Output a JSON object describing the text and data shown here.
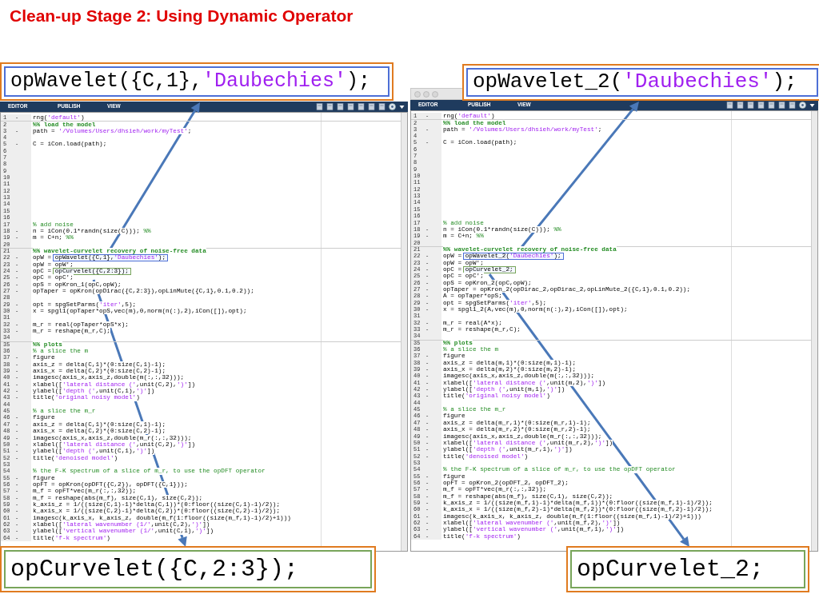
{
  "slide_title": "Clean-up Stage 2: Using Dynamic Operator",
  "callouts": [
    {
      "kind": "top-left",
      "color": "#4d6fd6",
      "parts": [
        {
          "kind": "code",
          "text": "opWavelet({C,1},"
        },
        {
          "kind": "string",
          "text": "'Daubechies'"
        },
        {
          "kind": "code",
          "text": ");"
        }
      ]
    },
    {
      "kind": "top-right",
      "color": "#4d6fd6",
      "parts": [
        {
          "kind": "code",
          "text": "opWavelet_2("
        },
        {
          "kind": "string",
          "text": "'Daubechies'"
        },
        {
          "kind": "code",
          "text": ");"
        }
      ]
    },
    {
      "kind": "bottom-left",
      "color": "#78a55a",
      "parts": [
        {
          "kind": "code",
          "text": "opCurvelet({C,2:3});"
        }
      ]
    },
    {
      "kind": "bottom-right",
      "color": "#78a55a",
      "parts": [
        {
          "kind": "code",
          "text": "opCurvelet_2;"
        }
      ]
    }
  ],
  "editors": [
    {
      "title_bar": false,
      "tabs": [
        {
          "label": "EDITOR"
        },
        {
          "label": "PUBLISH"
        },
        {
          "label": "VIEW"
        }
      ],
      "lines": [
        {
          "num": "1",
          "marker": "-",
          "parts": [
            {
              "kind": "code",
              "text": "rng("
            },
            {
              "kind": "string",
              "text": "'default'"
            },
            {
              "kind": "code",
              "text": ")"
            }
          ]
        },
        {
          "num": "2",
          "parts": [
            {
              "kind": "cell",
              "text": "%% load the model"
            }
          ]
        },
        {
          "num": "3",
          "marker": "-",
          "parts": [
            {
              "kind": "code",
              "text": "path = "
            },
            {
              "kind": "string",
              "text": "'/Volumes/Users/dhsieh/work/myTest'"
            },
            {
              "kind": "code",
              "text": ";"
            }
          ]
        },
        {
          "num": "4"
        },
        {
          "num": "5",
          "marker": "-",
          "parts": [
            {
              "kind": "code",
              "text": "C = iCon.load(path);"
            }
          ]
        },
        {
          "num": "6"
        },
        {
          "num": "7"
        },
        {
          "num": "8"
        },
        {
          "num": "9"
        },
        {
          "num": "10"
        },
        {
          "num": "11"
        },
        {
          "num": "12"
        },
        {
          "num": "13"
        },
        {
          "num": "14"
        },
        {
          "num": "15"
        },
        {
          "num": "16"
        },
        {
          "num": "17",
          "parts": [
            {
              "kind": "comment",
              "text": "% add noise"
            }
          ]
        },
        {
          "num": "18",
          "marker": "-",
          "parts": [
            {
              "kind": "code",
              "text": "n = iCon(0.1*randn(size(C))); "
            },
            {
              "kind": "comment",
              "text": "%%"
            }
          ]
        },
        {
          "num": "19",
          "marker": "-",
          "parts": [
            {
              "kind": "code",
              "text": "m = C+n; "
            },
            {
              "kind": "comment",
              "text": "%%"
            }
          ]
        },
        {
          "num": "20"
        },
        {
          "num": "21",
          "parts": [
            {
              "kind": "cell",
              "text": "%% wavelet-curvelet recovery of noise-free data"
            }
          ]
        },
        {
          "num": "22",
          "marker": "-",
          "parts": [
            {
              "kind": "code",
              "text": "opW = "
            },
            {
              "kind": "box",
              "color": "#4d6fd6",
              "parts": [
                {
                  "kind": "code",
                  "text": "opWavelet({C,1},"
                },
                {
                  "kind": "string",
                  "text": "'Daubechies'"
                },
                {
                  "kind": "code",
                  "text": ");"
                }
              ]
            }
          ]
        },
        {
          "num": "23",
          "marker": "-",
          "parts": [
            {
              "kind": "code",
              "text": "opW = opW';"
            }
          ]
        },
        {
          "num": "24",
          "marker": "-",
          "parts": [
            {
              "kind": "code",
              "text": "opC = "
            },
            {
              "kind": "box",
              "color": "#78a55a",
              "parts": [
                {
                  "kind": "code",
                  "text": "opCurvelet({C,2:3});"
                }
              ]
            }
          ]
        },
        {
          "num": "25",
          "marker": "-",
          "parts": [
            {
              "kind": "code",
              "text": "opC = opC';"
            }
          ]
        },
        {
          "num": "26",
          "marker": "-",
          "parts": [
            {
              "kind": "code",
              "text": "opS = opKron_1(opC,opW);"
            }
          ]
        },
        {
          "num": "27",
          "marker": "-",
          "parts": [
            {
              "kind": "code",
              "text": "opTaper = opKron(opDirac({C,2:3}),opLinMute({C,1},0.1,0.2));"
            }
          ]
        },
        {
          "num": "28"
        },
        {
          "num": "29",
          "marker": "-",
          "parts": [
            {
              "kind": "code",
              "text": "opt = spgSetParms("
            },
            {
              "kind": "string",
              "text": "'iter'"
            },
            {
              "kind": "code",
              "text": ",5);"
            }
          ]
        },
        {
          "num": "30",
          "marker": "-",
          "parts": [
            {
              "kind": "code",
              "text": "x = spgl1(opTaper*opS,vec(m),0,norm(n(:),2),iCon([]),opt);"
            }
          ]
        },
        {
          "num": "31"
        },
        {
          "num": "32",
          "marker": "-",
          "parts": [
            {
              "kind": "code",
              "text": "m_r = real(opTaper*opS*x);"
            }
          ]
        },
        {
          "num": "33",
          "marker": "-",
          "parts": [
            {
              "kind": "code",
              "text": "m_r = reshape(m_r,C);"
            }
          ]
        },
        {
          "num": "34"
        },
        {
          "num": "35",
          "parts": [
            {
              "kind": "cell",
              "text": "%% plots"
            }
          ]
        },
        {
          "num": "36",
          "parts": [
            {
              "kind": "comment",
              "text": "% a slice the m"
            }
          ]
        },
        {
          "num": "37",
          "marker": "-",
          "parts": [
            {
              "kind": "code",
              "text": "figure"
            }
          ]
        },
        {
          "num": "38",
          "marker": "-",
          "parts": [
            {
              "kind": "code",
              "text": "axis_z = delta(C,1)*(0:size(C,1)-1);"
            }
          ]
        },
        {
          "num": "39",
          "marker": "-",
          "parts": [
            {
              "kind": "code",
              "text": "axis_x = delta(C,2)*(0:size(C,2)-1);"
            }
          ]
        },
        {
          "num": "40",
          "marker": "-",
          "parts": [
            {
              "kind": "code",
              "text": "imagesc(axis_x,axis_z,double(m(:,:,32)));"
            }
          ]
        },
        {
          "num": "41",
          "marker": "-",
          "parts": [
            {
              "kind": "code",
              "text": "xlabel(["
            },
            {
              "kind": "string",
              "text": "'lateral distance ('"
            },
            {
              "kind": "code",
              "text": ",unit(C,2),"
            },
            {
              "kind": "string",
              "text": "')'"
            },
            {
              "kind": "code",
              "text": "])"
            }
          ]
        },
        {
          "num": "42",
          "marker": "-",
          "parts": [
            {
              "kind": "code",
              "text": "ylabel(["
            },
            {
              "kind": "string",
              "text": "'depth ('"
            },
            {
              "kind": "code",
              "text": ",unit(C,1),"
            },
            {
              "kind": "string",
              "text": "')'"
            },
            {
              "kind": "code",
              "text": "])"
            }
          ]
        },
        {
          "num": "43",
          "marker": "-",
          "parts": [
            {
              "kind": "code",
              "text": "title("
            },
            {
              "kind": "string",
              "text": "'original noisy model'"
            },
            {
              "kind": "code",
              "text": ")"
            }
          ]
        },
        {
          "num": "44"
        },
        {
          "num": "45",
          "parts": [
            {
              "kind": "comment",
              "text": "% a slice the m_r"
            }
          ]
        },
        {
          "num": "46",
          "marker": "-",
          "parts": [
            {
              "kind": "code",
              "text": "figure"
            }
          ]
        },
        {
          "num": "47",
          "marker": "-",
          "parts": [
            {
              "kind": "code",
              "text": "axis_z = delta(C,1)*(0:size(C,1)-1);"
            }
          ]
        },
        {
          "num": "48",
          "marker": "-",
          "parts": [
            {
              "kind": "code",
              "text": "axis_x = delta(C,2)*(0:size(C,2)-1);"
            }
          ]
        },
        {
          "num": "49",
          "marker": "-",
          "parts": [
            {
              "kind": "code",
              "text": "imagesc(axis_x,axis_z,double(m_r(:,:,32)));"
            }
          ]
        },
        {
          "num": "50",
          "marker": "-",
          "parts": [
            {
              "kind": "code",
              "text": "xlabel(["
            },
            {
              "kind": "string",
              "text": "'lateral distance ('"
            },
            {
              "kind": "code",
              "text": ",unit(C,2),"
            },
            {
              "kind": "string",
              "text": "')'"
            },
            {
              "kind": "code",
              "text": "])"
            }
          ]
        },
        {
          "num": "51",
          "marker": "-",
          "parts": [
            {
              "kind": "code",
              "text": "ylabel(["
            },
            {
              "kind": "string",
              "text": "'depth ('"
            },
            {
              "kind": "code",
              "text": ",unit(C,1),"
            },
            {
              "kind": "string",
              "text": "')'"
            },
            {
              "kind": "code",
              "text": "])"
            }
          ]
        },
        {
          "num": "52",
          "marker": "-",
          "parts": [
            {
              "kind": "code",
              "text": "title("
            },
            {
              "kind": "string",
              "text": "'denoised model'"
            },
            {
              "kind": "code",
              "text": ")"
            }
          ]
        },
        {
          "num": "53"
        },
        {
          "num": "54",
          "parts": [
            {
              "kind": "comment",
              "text": "% the F-K spectrum of a slice of m_r, to use the opDFT operator"
            }
          ]
        },
        {
          "num": "55",
          "marker": "-",
          "parts": [
            {
              "kind": "code",
              "text": "figure"
            }
          ]
        },
        {
          "num": "56",
          "marker": "-",
          "parts": [
            {
              "kind": "code",
              "text": "opFT = opKron(opDFT({C,2}), opDFT({C,1}));"
            }
          ]
        },
        {
          "num": "57",
          "marker": "-",
          "parts": [
            {
              "kind": "code",
              "text": "m_f = opFT*vec(m_r(:,:,32));"
            }
          ]
        },
        {
          "num": "58",
          "marker": "-",
          "parts": [
            {
              "kind": "code",
              "text": "m_f = reshape(abs(m_f), size(C,1), size(C,2));"
            }
          ]
        },
        {
          "num": "59",
          "marker": "-",
          "parts": [
            {
              "kind": "code",
              "text": "k_axis_z = 1/((size(C,1)-1)*delta(C,1))*(0:floor((size(C,1)-1)/2));"
            }
          ]
        },
        {
          "num": "60",
          "marker": "-",
          "parts": [
            {
              "kind": "code",
              "text": "k_axis_x = 1/((size(C,2)-1)*delta(C,2))*(0:floor((size(C,2)-1)/2));"
            }
          ]
        },
        {
          "num": "61",
          "marker": "-",
          "parts": [
            {
              "kind": "code",
              "text": "imagesc(k_axis_x, k_axis_z, double(m_f(1:floor((size(m_f,1)-1)/2)+1)))"
            }
          ]
        },
        {
          "num": "62",
          "marker": "-",
          "parts": [
            {
              "kind": "code",
              "text": "xlabel(["
            },
            {
              "kind": "string",
              "text": "'lateral wavenumber (1/'"
            },
            {
              "kind": "code",
              "text": ",unit(C,2),"
            },
            {
              "kind": "string",
              "text": "')'"
            },
            {
              "kind": "code",
              "text": "])"
            }
          ]
        },
        {
          "num": "63",
          "marker": "-",
          "parts": [
            {
              "kind": "code",
              "text": "ylabel(["
            },
            {
              "kind": "string",
              "text": "'vertical wavenumber (1/'"
            },
            {
              "kind": "code",
              "text": ",unit(C,1),"
            },
            {
              "kind": "string",
              "text": "')'"
            },
            {
              "kind": "code",
              "text": "])"
            }
          ]
        },
        {
          "num": "64",
          "marker": "-",
          "parts": [
            {
              "kind": "code",
              "text": "title("
            },
            {
              "kind": "string",
              "text": "'f-k spectrum'"
            },
            {
              "kind": "code",
              "text": ")"
            }
          ]
        }
      ]
    },
    {
      "title_bar": true,
      "tabs": [
        {
          "label": "EDITOR"
        },
        {
          "label": "PUBLISH"
        },
        {
          "label": "VIEW"
        }
      ],
      "lines": [
        {
          "num": "1",
          "marker": "-",
          "parts": [
            {
              "kind": "code",
              "text": "rng("
            },
            {
              "kind": "string",
              "text": "'default'"
            },
            {
              "kind": "code",
              "text": ")"
            }
          ]
        },
        {
          "num": "2",
          "parts": [
            {
              "kind": "cell",
              "text": "%% load the model"
            }
          ]
        },
        {
          "num": "3",
          "marker": "-",
          "parts": [
            {
              "kind": "code",
              "text": "path = "
            },
            {
              "kind": "string",
              "text": "'/Volumes/Users/dhsieh/work/myTest'"
            },
            {
              "kind": "code",
              "text": ";"
            }
          ]
        },
        {
          "num": "4"
        },
        {
          "num": "5",
          "marker": "-",
          "parts": [
            {
              "kind": "code",
              "text": "C = iCon.load(path);"
            }
          ]
        },
        {
          "num": "6"
        },
        {
          "num": "7"
        },
        {
          "num": "8"
        },
        {
          "num": "9"
        },
        {
          "num": "10"
        },
        {
          "num": "11"
        },
        {
          "num": "12"
        },
        {
          "num": "13"
        },
        {
          "num": "14"
        },
        {
          "num": "15"
        },
        {
          "num": "16"
        },
        {
          "num": "17",
          "parts": [
            {
              "kind": "comment",
              "text": "% add noise"
            }
          ]
        },
        {
          "num": "18",
          "marker": "-",
          "parts": [
            {
              "kind": "code",
              "text": "n = iCon(0.1*randn(size(C))); "
            },
            {
              "kind": "comment",
              "text": "%%"
            }
          ]
        },
        {
          "num": "19",
          "marker": "-",
          "parts": [
            {
              "kind": "code",
              "text": "m = C+n; "
            },
            {
              "kind": "comment",
              "text": "%%"
            }
          ]
        },
        {
          "num": "20"
        },
        {
          "num": "21",
          "parts": [
            {
              "kind": "cell",
              "text": "%% wavelet-curvelet recovery of noise-free data"
            }
          ]
        },
        {
          "num": "22",
          "marker": "-",
          "parts": [
            {
              "kind": "code",
              "text": "opW = "
            },
            {
              "kind": "box",
              "color": "#4d6fd6",
              "parts": [
                {
                  "kind": "code",
                  "text": "opWavelet_2("
                },
                {
                  "kind": "string",
                  "text": "'Daubechies'"
                },
                {
                  "kind": "code",
                  "text": ");"
                }
              ]
            }
          ]
        },
        {
          "num": "23",
          "marker": "-",
          "parts": [
            {
              "kind": "code",
              "text": "opW = opW';"
            }
          ]
        },
        {
          "num": "24",
          "marker": "-",
          "parts": [
            {
              "kind": "code",
              "text": "opC = "
            },
            {
              "kind": "box",
              "color": "#78a55a",
              "parts": [
                {
                  "kind": "code",
                  "text": "opCurvelet_2;"
                }
              ]
            }
          ]
        },
        {
          "num": "25",
          "marker": "-",
          "parts": [
            {
              "kind": "code",
              "text": "opC = opC';"
            }
          ]
        },
        {
          "num": "26",
          "marker": "-",
          "parts": [
            {
              "kind": "code",
              "text": "opS = opKron_2(opC,opW);"
            }
          ]
        },
        {
          "num": "27",
          "marker": "-",
          "parts": [
            {
              "kind": "code",
              "text": "opTaper = opKron_2(opDirac_2,opDirac_2,opLinMute_2({C,1},0.1,0.2));"
            }
          ]
        },
        {
          "num": "28",
          "marker": "-",
          "parts": [
            {
              "kind": "code",
              "text": "A = opTaper*opS;"
            }
          ]
        },
        {
          "num": "29",
          "marker": "-",
          "parts": [
            {
              "kind": "code",
              "text": "opt = spgSetParms("
            },
            {
              "kind": "string",
              "text": "'iter'"
            },
            {
              "kind": "code",
              "text": ",5);"
            }
          ]
        },
        {
          "num": "30",
          "marker": "-",
          "parts": [
            {
              "kind": "code",
              "text": "x = spgl1_2(A,vec(m),0,norm(n(:),2),iCon([]),opt);"
            }
          ]
        },
        {
          "num": "31"
        },
        {
          "num": "32",
          "marker": "-",
          "parts": [
            {
              "kind": "code",
              "text": "m_r = real(A*x);"
            }
          ]
        },
        {
          "num": "33",
          "marker": "-",
          "parts": [
            {
              "kind": "code",
              "text": "m_r = reshape(m_r,C);"
            }
          ]
        },
        {
          "num": "34"
        },
        {
          "num": "35",
          "parts": [
            {
              "kind": "cell",
              "text": "%% plots"
            }
          ]
        },
        {
          "num": "36",
          "parts": [
            {
              "kind": "comment",
              "text": "% a slice the m"
            }
          ]
        },
        {
          "num": "37",
          "marker": "-",
          "parts": [
            {
              "kind": "code",
              "text": "figure"
            }
          ]
        },
        {
          "num": "38",
          "marker": "-",
          "parts": [
            {
              "kind": "code",
              "text": "axis_z = delta(m,1)*(0:size(m,1)-1);"
            }
          ]
        },
        {
          "num": "39",
          "marker": "-",
          "parts": [
            {
              "kind": "code",
              "text": "axis_x = delta(m,2)*(0:size(m,2)-1);"
            }
          ]
        },
        {
          "num": "40",
          "marker": "-",
          "parts": [
            {
              "kind": "code",
              "text": "imagesc(axis_x,axis_z,double(m(:,:,32)));"
            }
          ]
        },
        {
          "num": "41",
          "marker": "-",
          "parts": [
            {
              "kind": "code",
              "text": "xlabel(["
            },
            {
              "kind": "string",
              "text": "'lateral distance ('"
            },
            {
              "kind": "code",
              "text": ",unit(m,2),"
            },
            {
              "kind": "string",
              "text": "')'"
            },
            {
              "kind": "code",
              "text": "])"
            }
          ]
        },
        {
          "num": "42",
          "marker": "-",
          "parts": [
            {
              "kind": "code",
              "text": "ylabel(["
            },
            {
              "kind": "string",
              "text": "'depth ('"
            },
            {
              "kind": "code",
              "text": ",unit(m,1),"
            },
            {
              "kind": "string",
              "text": "')'"
            },
            {
              "kind": "code",
              "text": "])"
            }
          ]
        },
        {
          "num": "43",
          "marker": "-",
          "parts": [
            {
              "kind": "code",
              "text": "title("
            },
            {
              "kind": "string",
              "text": "'original noisy model'"
            },
            {
              "kind": "code",
              "text": ")"
            }
          ]
        },
        {
          "num": "44"
        },
        {
          "num": "45",
          "parts": [
            {
              "kind": "comment",
              "text": "% a slice the m_r"
            }
          ]
        },
        {
          "num": "46",
          "marker": "-",
          "parts": [
            {
              "kind": "code",
              "text": "figure"
            }
          ]
        },
        {
          "num": "47",
          "marker": "-",
          "parts": [
            {
              "kind": "code",
              "text": "axis_z = delta(m_r,1)*(0:size(m_r,1)-1);"
            }
          ]
        },
        {
          "num": "48",
          "marker": "-",
          "parts": [
            {
              "kind": "code",
              "text": "axis_x = delta(m_r,2)*(0:size(m_r,2)-1);"
            }
          ]
        },
        {
          "num": "49",
          "marker": "-",
          "parts": [
            {
              "kind": "code",
              "text": "imagesc(axis_x,axis_z,double(m_r(:,:,32)));"
            }
          ]
        },
        {
          "num": "50",
          "marker": "-",
          "parts": [
            {
              "kind": "code",
              "text": "xlabel(["
            },
            {
              "kind": "string",
              "text": "'lateral distance ('"
            },
            {
              "kind": "code",
              "text": ",unit(m_r,2),"
            },
            {
              "kind": "string",
              "text": "')'"
            },
            {
              "kind": "code",
              "text": "])"
            }
          ]
        },
        {
          "num": "51",
          "marker": "-",
          "parts": [
            {
              "kind": "code",
              "text": "ylabel(["
            },
            {
              "kind": "string",
              "text": "'depth ('"
            },
            {
              "kind": "code",
              "text": ",unit(m_r,1),"
            },
            {
              "kind": "string",
              "text": "')'"
            },
            {
              "kind": "code",
              "text": "])"
            }
          ]
        },
        {
          "num": "52",
          "marker": "-",
          "parts": [
            {
              "kind": "code",
              "text": "title("
            },
            {
              "kind": "string",
              "text": "'denoised model'"
            },
            {
              "kind": "code",
              "text": ")"
            }
          ]
        },
        {
          "num": "53"
        },
        {
          "num": "54",
          "parts": [
            {
              "kind": "comment",
              "text": "% the F-K spectrum of a slice of m_r, to use the opDFT operator"
            }
          ]
        },
        {
          "num": "55",
          "marker": "-",
          "parts": [
            {
              "kind": "code",
              "text": "figure"
            }
          ]
        },
        {
          "num": "56",
          "marker": "-",
          "parts": [
            {
              "kind": "code",
              "text": "opFT = opKron_2(opDFT_2, opDFT_2);"
            }
          ]
        },
        {
          "num": "57",
          "marker": "-",
          "parts": [
            {
              "kind": "code",
              "text": "m_f = opFT*vec(m_r(:,:,32));"
            }
          ]
        },
        {
          "num": "58",
          "marker": "-",
          "parts": [
            {
              "kind": "code",
              "text": "m_f = reshape(abs(m_f), size(C,1), size(C,2));"
            }
          ]
        },
        {
          "num": "59",
          "marker": "-",
          "parts": [
            {
              "kind": "code",
              "text": "k_axis_z = 1/((size(m_f,1)-1)*delta(m_f,1))*(0:floor((size(m_f,1)-1)/2));"
            }
          ]
        },
        {
          "num": "60",
          "marker": "-",
          "parts": [
            {
              "kind": "code",
              "text": "k_axis_x = 1/((size(m_f,2)-1)*delta(m_f,2))*(0:floor((size(m_f,2)-1)/2));"
            }
          ]
        },
        {
          "num": "61",
          "marker": "-",
          "parts": [
            {
              "kind": "code",
              "text": "imagesc(k_axis_x, k_axis_z, double(m_f(1:floor((size(m_f,1)-1)/2)+1)))"
            }
          ]
        },
        {
          "num": "62",
          "marker": "-",
          "parts": [
            {
              "kind": "code",
              "text": "xlabel(["
            },
            {
              "kind": "string",
              "text": "'lateral wavenumber ('"
            },
            {
              "kind": "code",
              "text": ",unit(m_f,2),"
            },
            {
              "kind": "string",
              "text": "')'"
            },
            {
              "kind": "code",
              "text": "])"
            }
          ]
        },
        {
          "num": "63",
          "marker": "-",
          "parts": [
            {
              "kind": "code",
              "text": "ylabel(["
            },
            {
              "kind": "string",
              "text": "'vertical wavenumber ('"
            },
            {
              "kind": "code",
              "text": ",unit(m_f,1),"
            },
            {
              "kind": "string",
              "text": "')'"
            },
            {
              "kind": "code",
              "text": "])"
            }
          ]
        },
        {
          "num": "64",
          "marker": "-",
          "parts": [
            {
              "kind": "code",
              "text": "title("
            },
            {
              "kind": "string",
              "text": "'f-k spectrum'"
            },
            {
              "kind": "code",
              "text": ")"
            }
          ]
        }
      ]
    }
  ]
}
